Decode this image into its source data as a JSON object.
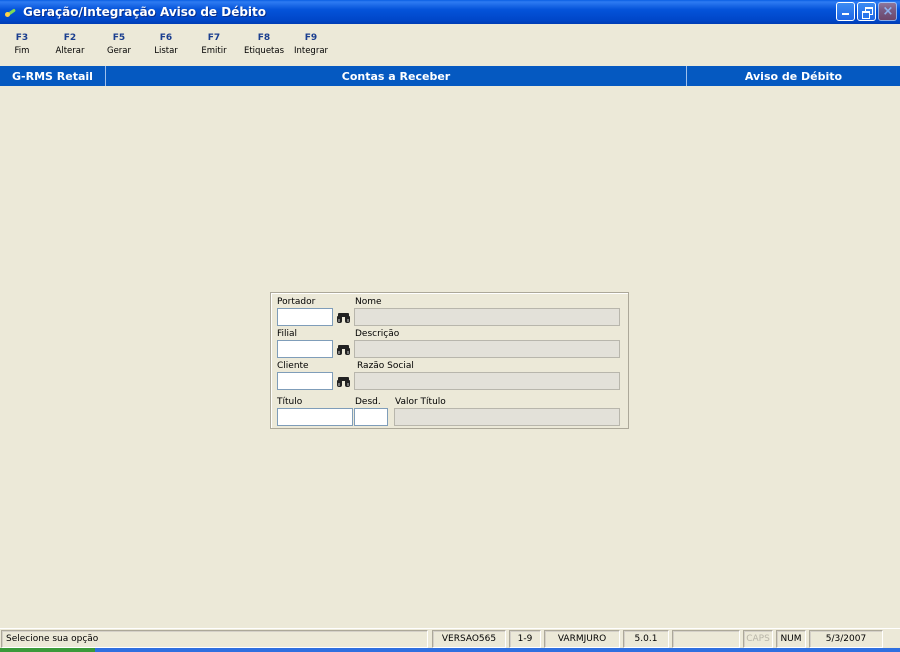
{
  "window": {
    "title": "Geração/Integração Aviso de Débito"
  },
  "toolbar": {
    "keys": [
      {
        "key": "F3",
        "label": "Fim"
      },
      {
        "key": "F2",
        "label": "Alterar"
      },
      {
        "key": "F5",
        "label": "Gerar"
      },
      {
        "key": "F6",
        "label": "Listar"
      },
      {
        "key": "F7",
        "label": "Emitir"
      },
      {
        "key": "F8",
        "label": "Etiquetas"
      },
      {
        "key": "F9",
        "label": "Integrar"
      }
    ]
  },
  "header_band": {
    "left": "G-RMS Retail",
    "center": "Contas a Receber",
    "right": "Aviso de Débito"
  },
  "form": {
    "portador_label": "Portador",
    "portador_value": "",
    "nome_label": "Nome",
    "nome_value": "",
    "filial_label": "Filial",
    "filial_value": "",
    "descricao_label": "Descrição",
    "descricao_value": "",
    "cliente_label": "Cliente",
    "cliente_value": "",
    "razao_label": "Razão Social",
    "razao_value": "",
    "titulo_label": "Título",
    "titulo_value": "",
    "desd_label": "Desd.",
    "desd_value": "",
    "valor_label": "Valor Título",
    "valor_value": ""
  },
  "icons": {
    "lookup": "binoculars-icon",
    "app": "app-icon",
    "minimize": "minimize-icon",
    "restore": "restore-icon",
    "close": "close-icon"
  },
  "statusbar": {
    "message": "Selecione sua opção",
    "version": "VERSAO565",
    "range": "1-9",
    "user": "VARMJURO",
    "build": "5.0.1",
    "blank": "",
    "caps": "CAPS",
    "num": "NUM",
    "date": "5/3/2007"
  }
}
